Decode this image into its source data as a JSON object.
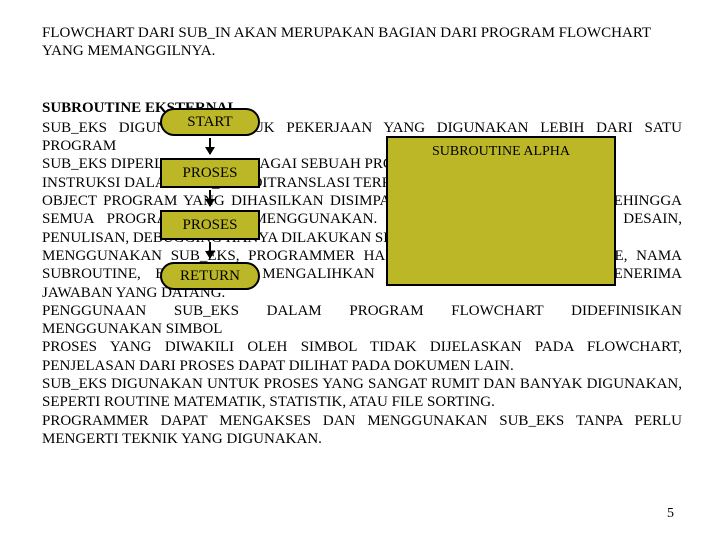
{
  "intro": "FLOWCHART DARI SUB_IN AKAN MERUPAKAN BAGIAN DARI PROGRAM FLOWCHART YANG MEMANGGILNYA.",
  "heading": "SUBROUTINE EKSTERNAL",
  "paragraphs": [
    "SUB_EKS DIGUNAKAN UNTUK PEKERJAAN YANG DIGUNAKAN LEBIH DARI SATU PROGRAM",
    "SUB_EKS DIPERLAKUKAN SEBAGAI SEBUAH PROGRAM.",
    "INSTRUKSI DALAM SUB_EKS DITRANSLASI TERPISAH DARI PROGRAM LAIN.",
    "OBJECT PROGRAM YANG DIHASILKAN DISIMPAN DALAM SEBUAH LIBRARI, SEHINGGA SEMUA PROGRAM DAPAT MENGGUNAKAN. DENGAN DEMIKIAN PROSES DESAIN, PENULISAN, DEBUGGING HANYA DILAKUKAN SEKALI.",
    "MENGGUNAKAN SUB_EKS, PROGRAMMER HARUS TAHU LETAK SUBROUTINE, NAMA SUBROUTINE, BAGAIMANA MENGALIHKAN DATA, DAN BAGAIMANA MENERIMA JAWABAN YANG DATANG.",
    "PENGGUNAAN SUB_EKS DALAM PROGRAM FLOWCHART DIDEFINISIKAN MENGGUNAKAN SIMBOL",
    "PROSES YANG DIWAKILI OLEH SIMBOL TIDAK DIJELASKAN PADA FLOWCHART, PENJELASAN DARI PROSES DAPAT DILIHAT PADA DOKUMEN LAIN.",
    "SUB_EKS DIGUNAKAN UNTUK PROSES YANG SANGAT RUMIT DAN BANYAK DIGUNAKAN, SEPERTI ROUTINE MATEMATIK, STATISTIK, ATAU FILE SORTING.",
    "PROGRAMMER DAPAT MENGAKSES DAN MENGGUNAKAN SUB_EKS TANPA PERLU MENGERTI TEKNIK YANG DIGUNAKAN."
  ],
  "flowchart": {
    "start": "START",
    "proses1": "PROSES",
    "proses2": "PROSES",
    "return": "RETURN",
    "subroutine": "SUBROUTINE ALPHA"
  },
  "page_number": "5"
}
